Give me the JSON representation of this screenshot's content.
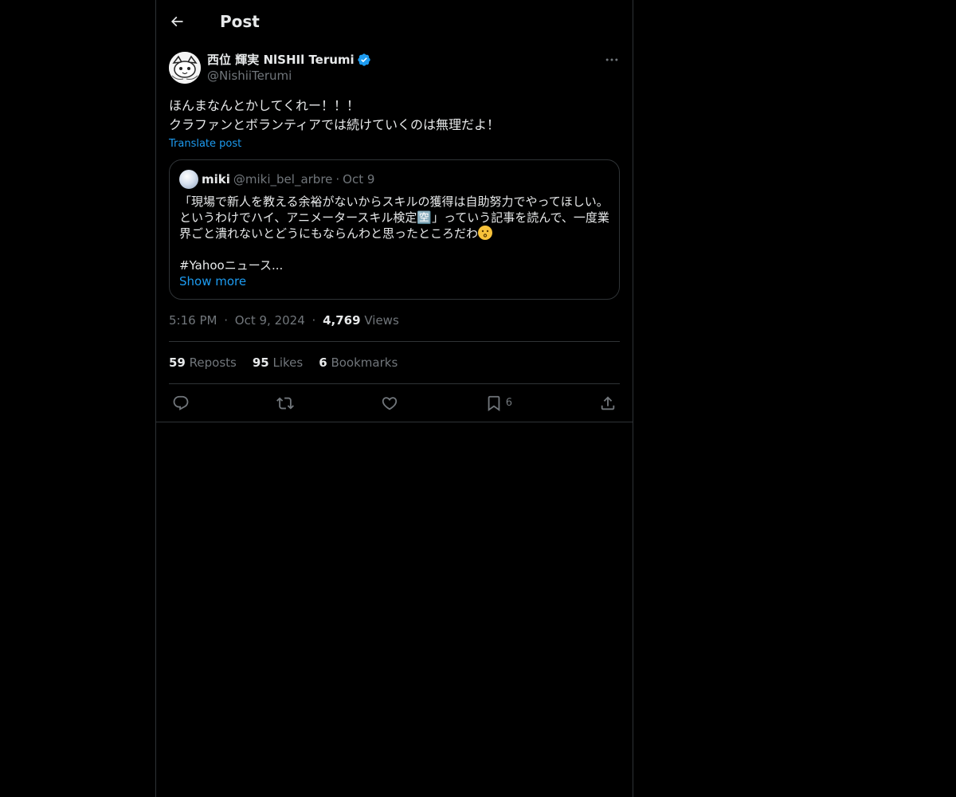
{
  "header": {
    "title": "Post"
  },
  "post": {
    "author": {
      "name": "西位 輝実 NlSHIl Terumi",
      "handle": "@NishiiTerumi"
    },
    "text_lines": [
      "ほんまなんとかしてくれー！！！",
      "クラファンとボランティアでは続けていくのは無理だよ！"
    ],
    "translate_label": "Translate post",
    "quote": {
      "name": "miki",
      "handle": "@miki_bel_arbre",
      "separator": "·",
      "date": "Oct 9",
      "body_lines": [
        "「現場で新人を教える余裕がないからスキルの獲得は自助努力でやってほしい。",
        "というわけでハイ、アニメータースキル検定🈳」っていう記事を読んで、一度業",
        "界ごと潰れないとどうにもならんわと思ったところだわ"
      ],
      "hashtag_line": "#Yahooニュース...",
      "show_more": "Show more"
    },
    "timestamp": {
      "time": "5:16 PM",
      "separator": "·",
      "date": "Oct 9, 2024",
      "views_count": "4,769",
      "views_label": "Views"
    },
    "stats": {
      "reposts_count": "59",
      "reposts_label": "Reposts",
      "likes_count": "95",
      "likes_label": "Likes",
      "bookmarks_count": "6",
      "bookmarks_label": "Bookmarks"
    },
    "actions": {
      "bookmark_count": "6"
    }
  },
  "colors": {
    "background": "#000000",
    "text": "#e7e9ea",
    "muted": "#71767b",
    "accent": "#1d9bf0",
    "border": "#2f3336"
  },
  "icons": [
    "back-arrow-icon",
    "verified-badge-icon",
    "more-icon",
    "reply-icon",
    "repost-icon",
    "like-icon",
    "bookmark-icon",
    "share-icon",
    "kissing-face-emoji"
  ]
}
